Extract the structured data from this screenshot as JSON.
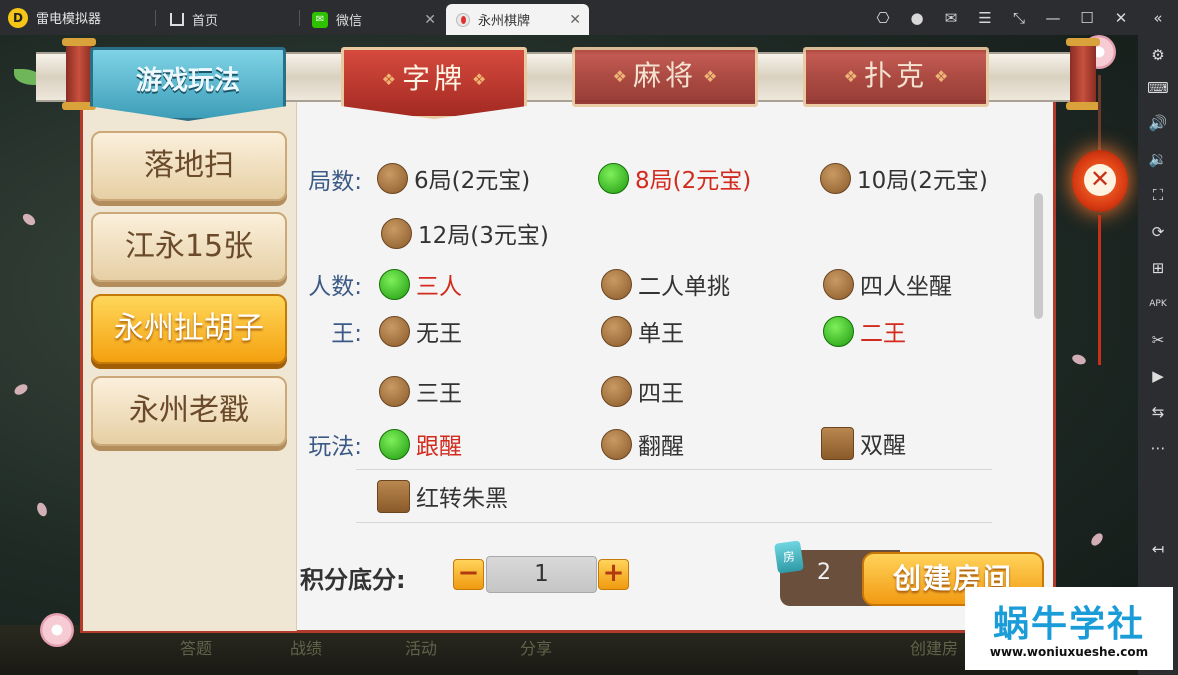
{
  "app": {
    "brand": "雷电模拟器",
    "tabs": [
      {
        "label": "首页",
        "icon": "home-icon"
      },
      {
        "label": "微信",
        "icon": "wechat-icon"
      },
      {
        "label": "永州棋牌",
        "icon": "game-icon",
        "active": true
      }
    ],
    "system_icons": [
      "gamepad-icon",
      "user-icon",
      "mail-icon",
      "menu-icon",
      "shrink-icon",
      "minimize-icon",
      "maximize-icon",
      "close-icon",
      "collapse-icon"
    ]
  },
  "sidebar": {
    "items": [
      "settings-icon",
      "keyboard-icon",
      "volume-up-icon",
      "volume-down-icon",
      "fullscreen-icon",
      "rotate-icon",
      "add-window-icon",
      "apk-icon",
      "scissors-icon",
      "video-icon",
      "sync-icon",
      "more-icon",
      "back-icon"
    ]
  },
  "game": {
    "rules_title": "游戏玩法",
    "categories": [
      {
        "label": "字牌",
        "active": true
      },
      {
        "label": "麻将",
        "active": false
      },
      {
        "label": "扑克",
        "active": false
      }
    ],
    "games": [
      {
        "label": "落地扫",
        "active": false
      },
      {
        "label": "江永15张",
        "active": false
      },
      {
        "label": "永州扯胡子",
        "active": true
      },
      {
        "label": "永州老戳",
        "active": false
      }
    ],
    "options": {
      "rounds_label": "局数:",
      "rounds": [
        {
          "label": "6局(2元宝)",
          "selected": false
        },
        {
          "label": "8局(2元宝)",
          "selected": true
        },
        {
          "label": "10局(2元宝)",
          "selected": false
        },
        {
          "label": "12局(3元宝)",
          "selected": false
        }
      ],
      "players_label": "人数:",
      "players": [
        {
          "label": "三人",
          "selected": true
        },
        {
          "label": "二人单挑",
          "selected": false
        },
        {
          "label": "四人坐醒",
          "selected": false
        }
      ],
      "king_label": "王:",
      "king": [
        {
          "label": "无王",
          "selected": false
        },
        {
          "label": "单王",
          "selected": false
        },
        {
          "label": "二王",
          "selected": true
        },
        {
          "label": "三王",
          "selected": false
        },
        {
          "label": "四王",
          "selected": false
        }
      ],
      "play_label": "玩法:",
      "play": [
        {
          "label": "跟醒",
          "selected": true,
          "kind": "radio"
        },
        {
          "label": "翻醒",
          "selected": false,
          "kind": "radio"
        },
        {
          "label": "双醒",
          "selected": false,
          "kind": "checkbox"
        },
        {
          "label": "红转朱黑",
          "selected": false,
          "kind": "checkbox"
        }
      ]
    },
    "score": {
      "label": "积分底分:",
      "value": "1",
      "minus": "−",
      "plus": "+"
    },
    "room": {
      "count": "2",
      "icon_label": "房",
      "create_label": "创建房间"
    },
    "close_label": "✕",
    "background_labels": [
      "答题",
      "战绩",
      "活动",
      "分享",
      "创建房"
    ]
  },
  "watermark": {
    "title": "蜗牛学社",
    "url": "www.woniuxueshe.com"
  },
  "colors": {
    "selected_text": "#d22a1d",
    "label_blue": "#3c5a86",
    "accent_gold": "#f4a10f",
    "banner_red": "#a32a22"
  }
}
